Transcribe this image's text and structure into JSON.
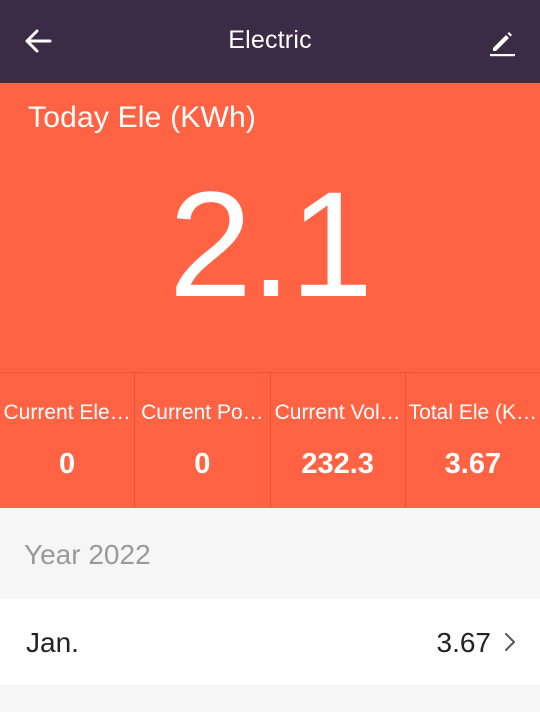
{
  "header": {
    "title": "Electric",
    "back_icon": "arrow-left-icon",
    "edit_icon": "pencil-icon"
  },
  "hero": {
    "label": "Today Ele (KWh)",
    "value": "2.1"
  },
  "stats": [
    {
      "label": "Current Ele…",
      "value": "0"
    },
    {
      "label": "Current Po…",
      "value": "0"
    },
    {
      "label": "Current Vol…",
      "value": "232.3"
    },
    {
      "label": "Total Ele (K…",
      "value": "3.67"
    }
  ],
  "history": {
    "year_label": "Year 2022",
    "months": [
      {
        "label": "Jan.",
        "value": "3.67"
      }
    ]
  },
  "colors": {
    "header_bg": "#3c2b45",
    "accent": "#ff6344",
    "page_bg": "#f6f6f6"
  }
}
